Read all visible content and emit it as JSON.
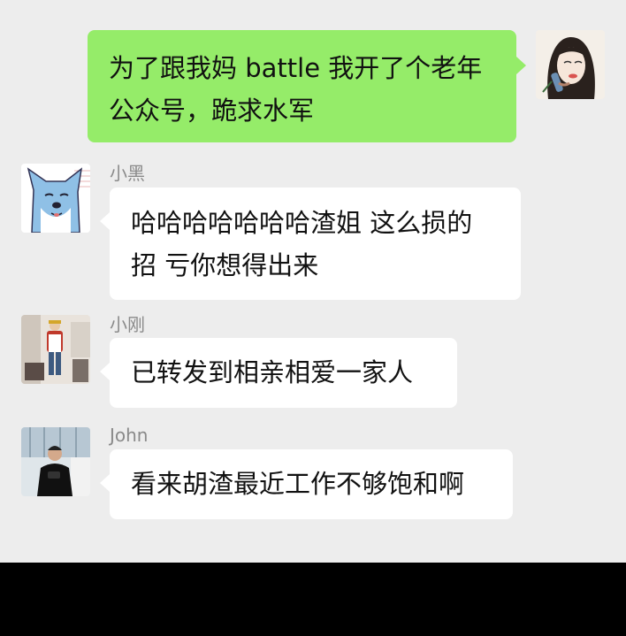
{
  "colors": {
    "background": "#ededed",
    "self_bubble": "#95ec69",
    "other_bubble": "#ffffff",
    "name_text": "#8a8a8a",
    "message_text": "#111111"
  },
  "messages": [
    {
      "sender": "me",
      "avatar_icon": "woman-sketch-avatar-icon",
      "lines": [
        "为了跟我妈 battle 我开了个老年",
        "公众号，跪求水军"
      ]
    },
    {
      "sender": "小黑",
      "avatar_icon": "shiba-dog-avatar-icon",
      "lines": [
        "哈哈哈哈哈哈哈渣姐 这么损的",
        "招 亏你想得出来"
      ]
    },
    {
      "sender": "小刚",
      "avatar_icon": "person-red-jacket-avatar-icon",
      "lines": [
        "已转发到相亲相爱一家人"
      ]
    },
    {
      "sender": "John",
      "avatar_icon": "man-black-shirt-avatar-icon",
      "lines": [
        "看来胡渣最近工作不够饱和啊"
      ]
    }
  ]
}
